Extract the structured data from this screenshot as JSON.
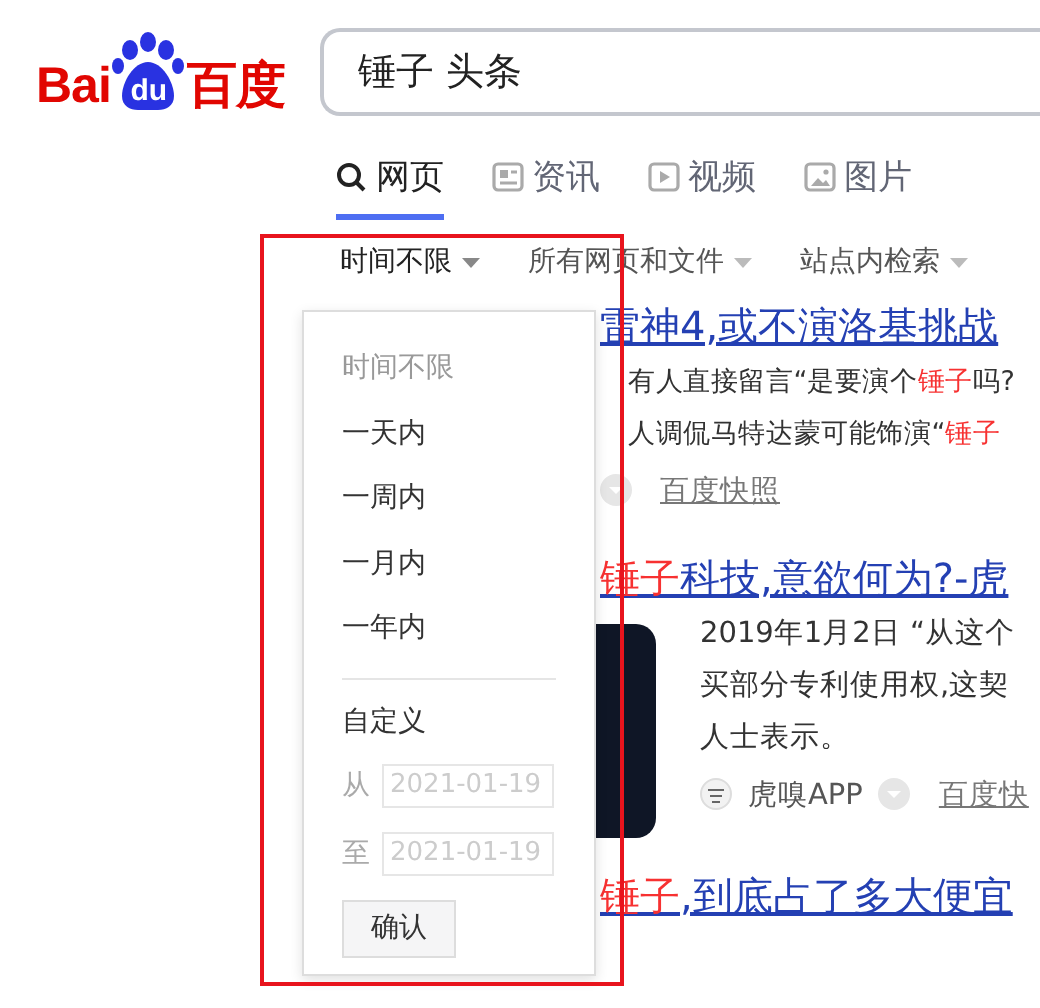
{
  "logo": {
    "left": "Bai",
    "paw": "du",
    "right": "百度"
  },
  "search": {
    "value": "锤子 头条"
  },
  "tabs": [
    {
      "label": "网页",
      "selected": true
    },
    {
      "label": "资讯",
      "selected": false
    },
    {
      "label": "视频",
      "selected": false
    },
    {
      "label": "图片",
      "selected": false
    }
  ],
  "filters": [
    {
      "label": "时间不限",
      "open": true
    },
    {
      "label": "所有网页和文件",
      "open": false
    },
    {
      "label": "站点内检索",
      "open": false
    }
  ],
  "results": [
    {
      "kind": "text",
      "title": "雷神4,或不演洛基挑战",
      "snippet": [
        "有人直接留言“是要演个**锤子**吗?",
        "人调侃马特达蒙可能饰演“**锤子**"
      ],
      "snapshot": "百度快照"
    },
    {
      "kind": "image",
      "title": "**锤子**科技,意欲何为?-虎",
      "snippet": [
        "2019年1月2日 “从这个",
        "买部分专利使用权,这契",
        "人士表示。"
      ],
      "source": "虎嗅APP",
      "snapshot": "百度快"
    },
    {
      "kind": "text",
      "title": "**锤子**,到底占了多大便宜"
    }
  ],
  "time_menu": {
    "options": [
      {
        "label": "时间不限",
        "selected": true
      },
      {
        "label": "一天内",
        "selected": false
      },
      {
        "label": "一周内",
        "selected": false
      },
      {
        "label": "一月内",
        "selected": false
      },
      {
        "label": "一年内",
        "selected": false
      }
    ],
    "custom_label": "自定义",
    "from_label": "从",
    "from_value": "2021-01-19",
    "to_label": "至",
    "to_value": "2021-01-19",
    "confirm": "确认"
  },
  "annotation": {
    "visible": true
  }
}
